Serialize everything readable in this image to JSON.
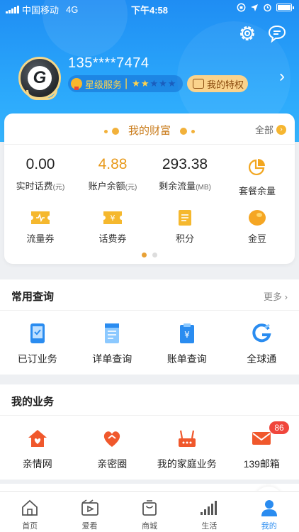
{
  "status": {
    "carrier": "中国移动",
    "network": "4G",
    "time": "下午4:58"
  },
  "header": {
    "phone": "135****7474",
    "star_service": "星级服务",
    "stars_filled": 2,
    "stars_total": 5,
    "privilege_label": "我的特权"
  },
  "wealth": {
    "title": "我的财富",
    "all_label": "全部",
    "stats": [
      {
        "value": "0.00",
        "label": "实时话费",
        "unit": "(元)"
      },
      {
        "value": "4.88",
        "label": "账户余额",
        "unit": "(元)"
      },
      {
        "value": "293.38",
        "label": "剩余流量",
        "unit": "(MB)"
      },
      {
        "value": "",
        "label": "套餐余量",
        "unit": ""
      }
    ],
    "coupons": [
      {
        "label": "流量券",
        "icon": "data-coupon-icon"
      },
      {
        "label": "话费券",
        "icon": "fee-coupon-icon"
      },
      {
        "label": "积分",
        "icon": "points-icon"
      },
      {
        "label": "金豆",
        "icon": "gold-bean-icon"
      }
    ],
    "page_index": 0,
    "page_count": 2
  },
  "common_query": {
    "title": "常用查询",
    "more": "更多",
    "items": [
      {
        "label": "已订业务",
        "icon": "subscribed-icon"
      },
      {
        "label": "详单查询",
        "icon": "detail-list-icon"
      },
      {
        "label": "账单查询",
        "icon": "bill-icon"
      },
      {
        "label": "全球通",
        "icon": "global-icon"
      }
    ]
  },
  "my_business": {
    "title": "我的业务",
    "items": [
      {
        "label": "亲情网",
        "icon": "family-network-icon"
      },
      {
        "label": "亲密圈",
        "icon": "intimate-circle-icon"
      },
      {
        "label": "我的家庭业务",
        "icon": "home-router-icon"
      },
      {
        "label": "139邮箱",
        "icon": "mail-icon",
        "badge": "86"
      }
    ]
  },
  "tabs": [
    {
      "label": "首页",
      "icon": "home-icon"
    },
    {
      "label": "爱看",
      "icon": "video-icon"
    },
    {
      "label": "商城",
      "icon": "shop-icon"
    },
    {
      "label": "生活",
      "icon": "life-icon"
    },
    {
      "label": "我的",
      "icon": "me-icon"
    }
  ],
  "active_tab": "我的",
  "colors": {
    "header_blue": "#2aa7fb",
    "orange": "#e89a1c",
    "icon_blue": "#2a8cf0",
    "icon_red": "#f0582c",
    "badge_red": "#f0463c"
  }
}
